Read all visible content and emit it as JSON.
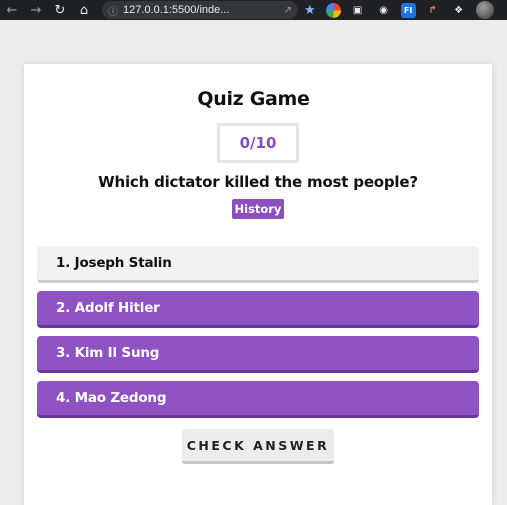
{
  "browser": {
    "url": "127.0.0.1:5500/inde...",
    "back_icon": "arrow-left",
    "forward_icon": "arrow-right",
    "reload_icon": "reload",
    "home_icon": "home",
    "extensions": {
      "fi_label": "FI"
    }
  },
  "quiz": {
    "title": "Quiz Game",
    "score": "0/10",
    "question": "Which dictator killed the most people?",
    "category": "History",
    "options": [
      {
        "label": "1. Joseph Stalin",
        "state": "selected"
      },
      {
        "label": "2. Adolf Hitler",
        "state": "normal"
      },
      {
        "label": "3. Kim Il Sung",
        "state": "normal"
      },
      {
        "label": "4. Mao Zedong",
        "state": "normal"
      }
    ],
    "check_button": "CHECK ANSWER"
  },
  "colors": {
    "accent": "#8e52c2",
    "accent_dark": "#6a3598",
    "selected_option_bg": "#f1f1f1",
    "page_bg": "#ececec"
  }
}
